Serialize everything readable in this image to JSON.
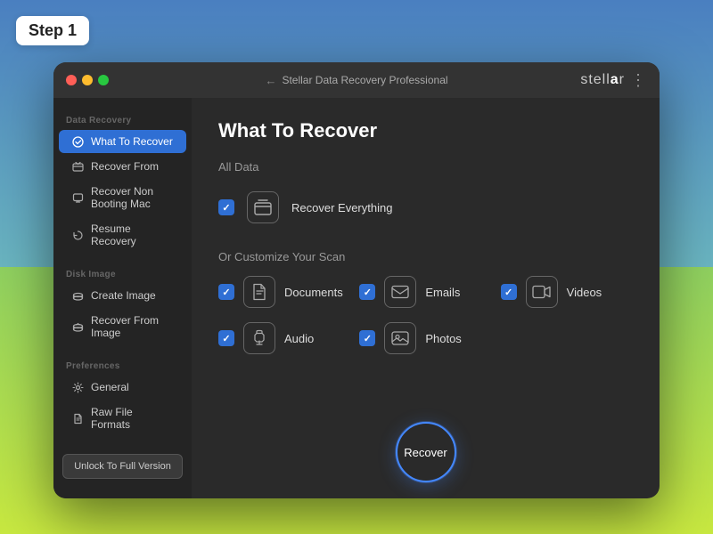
{
  "step_badge": "Step 1",
  "title_bar": {
    "title": "Stellar Data Recovery Professional",
    "back_label": "←",
    "logo": "stellar",
    "menu_icon": "⋮"
  },
  "sidebar": {
    "sections": [
      {
        "label": "Data Recovery",
        "items": [
          {
            "id": "what-to-recover",
            "label": "What To Recover",
            "active": true,
            "icon": "circle-arrow"
          },
          {
            "id": "recover-from",
            "label": "Recover From",
            "active": false,
            "icon": "folder-clock"
          },
          {
            "id": "recover-non-booting",
            "label": "Recover Non Booting Mac",
            "active": false,
            "icon": "mac-icon"
          },
          {
            "id": "resume-recovery",
            "label": "Resume Recovery",
            "active": false,
            "icon": "refresh"
          }
        ]
      },
      {
        "label": "Disk Image",
        "items": [
          {
            "id": "create-image",
            "label": "Create Image",
            "active": false,
            "icon": "disk"
          },
          {
            "id": "recover-from-image",
            "label": "Recover From Image",
            "active": false,
            "icon": "disk-arrow"
          }
        ]
      },
      {
        "label": "Preferences",
        "items": [
          {
            "id": "general",
            "label": "General",
            "active": false,
            "icon": "gear"
          },
          {
            "id": "raw-file-formats",
            "label": "Raw File Formats",
            "active": false,
            "icon": "file"
          }
        ]
      }
    ],
    "unlock_btn": "Unlock To Full Version"
  },
  "main": {
    "page_title": "What To Recover",
    "all_data_label": "All Data",
    "recover_everything_label": "Recover Everything",
    "customize_label": "Or Customize Your Scan",
    "items": [
      {
        "id": "documents",
        "label": "Documents",
        "checked": true
      },
      {
        "id": "emails",
        "label": "Emails",
        "checked": true
      },
      {
        "id": "videos",
        "label": "Videos",
        "checked": true
      },
      {
        "id": "audio",
        "label": "Audio",
        "checked": true
      },
      {
        "id": "photos",
        "label": "Photos",
        "checked": true
      }
    ],
    "recover_btn": "Recover"
  }
}
